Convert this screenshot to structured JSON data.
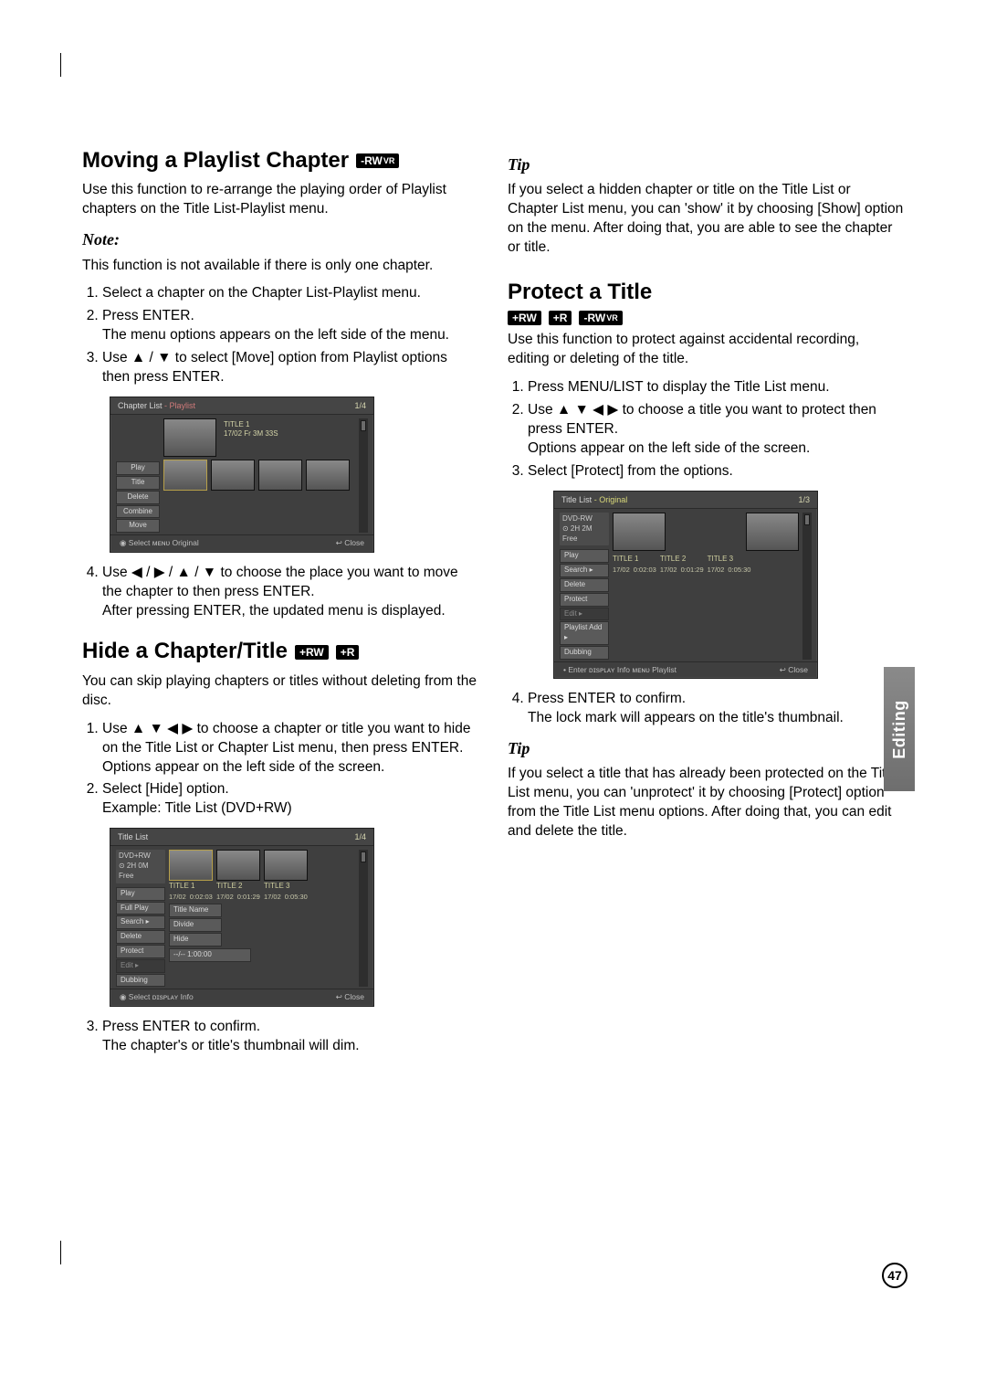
{
  "page_number": "47",
  "side_tab": "Editing",
  "left": {
    "section1": {
      "heading": "Moving a Playlist Chapter",
      "badge1": "-RW",
      "badge1_sub": "VR",
      "intro": "Use this function to re-arrange the playing order of Playlist chapters on the Title List-Playlist menu.",
      "note_label": "Note:",
      "note_body": "This function is not available if there is only one chapter.",
      "steps": [
        "Select a chapter on the Chapter List-Playlist menu.",
        "Press ENTER.\nThe menu options appears on the left side of the menu.",
        "Use ▲ / ▼ to select [Move] option from Playlist options then press ENTER.",
        "Use ◀ / ▶ / ▲ / ▼ to choose the place you want to move the chapter to then press ENTER.\nAfter pressing ENTER, the updated menu is displayed."
      ],
      "osd": {
        "title_left": "Chapter List",
        "title_mode": "- Playlist",
        "title_right": "1/4",
        "info_title": "TITLE 1",
        "info_sub": "17/02 Fr   3M 33S",
        "buttons": [
          "Play",
          "Title",
          "Delete",
          "Combine",
          "Move"
        ],
        "footer_left": "◉ Select  ᴍᴇɴᴜ Original",
        "footer_right": "↩ Close"
      }
    },
    "section2": {
      "heading": "Hide a Chapter/Title",
      "badge1": "+RW",
      "badge2": "+R",
      "intro": "You can skip playing chapters or titles without deleting from the disc.",
      "steps": [
        "Use ▲ ▼ ◀ ▶ to choose a chapter or title you want to hide on the Title List or Chapter List menu, then press ENTER.\nOptions appear on the left side of the screen.",
        "Select [Hide] option.\nExample: Title List (DVD+RW)",
        "Press ENTER to confirm.\nThe chapter's or title's thumbnail will dim."
      ],
      "osd": {
        "title_left": "Title List",
        "title_right": "1/4",
        "disc": "DVD+RW",
        "free": "⊙ 2H 0M\n    Free",
        "buttons": [
          "Play",
          "Full Play",
          "Search ▸",
          "Delete",
          "Protect",
          "Edit ▸",
          "Dubbing"
        ],
        "sub_buttons": [
          "Title Name",
          "Divide",
          "Hide"
        ],
        "titles": [
          {
            "name": "TITLE 1",
            "date": "17/02",
            "len": "0:02:03"
          },
          {
            "name": "TITLE 2",
            "date": "17/02",
            "len": "0:01:29"
          },
          {
            "name": "TITLE 3",
            "date": "17/02",
            "len": "0:05:30"
          }
        ],
        "extra_row": "--/--    1:00:00",
        "footer_left": "◉ Select  ᴅɪsᴘʟᴀʏ Info",
        "footer_right": "↩ Close"
      }
    }
  },
  "right": {
    "tip1_label": "Tip",
    "tip1_body": "If you select a hidden chapter or title on the Title List or Chapter List menu, you can 'show' it by choosing [Show] option on the menu. After doing that, you are able to see the chapter or title.",
    "section3": {
      "heading": "Protect a Title",
      "badges": [
        {
          "text": "+RW"
        },
        {
          "text": "+R"
        },
        {
          "text": "-RW",
          "sub": "VR"
        }
      ],
      "intro": "Use this function to protect against accidental recording, editing or deleting of the title.",
      "steps": [
        "Press MENU/LIST to display the Title List menu.",
        "Use ▲ ▼ ◀ ▶ to choose a title you want to protect then press ENTER.\nOptions appear on the left side of the screen.",
        "Select [Protect] from the options.",
        "Press ENTER to confirm.\nThe lock mark will appears on the title's thumbnail."
      ],
      "osd": {
        "title_left": "Title List",
        "title_mode": "- Original",
        "title_right": "1/3",
        "disc": "DVD-RW",
        "free": "⊙ 2H 2M\n    Free",
        "buttons": [
          "Play",
          "Search ▸",
          "Delete",
          "Protect",
          "Edit ▸",
          "Playlist Add ▸",
          "Dubbing"
        ],
        "titles": [
          {
            "name": "TITLE 1",
            "date": "17/02",
            "len": "0:02:03"
          },
          {
            "name": "TITLE 2",
            "date": "17/02",
            "len": "0:01:29"
          },
          {
            "name": "TITLE 3",
            "date": "17/02",
            "len": "0:05:30"
          }
        ],
        "footer_left": "• Enter  ᴅɪsᴘʟᴀʏ Info  ᴍᴇɴᴜ Playlist",
        "footer_right": "↩ Close"
      }
    },
    "tip2_label": "Tip",
    "tip2_body": "If you select a title that has already been protected on the Title List menu, you can 'unprotect' it by choosing [Protect] option from the Title List menu options. After doing that, you can edit and delete the title."
  }
}
